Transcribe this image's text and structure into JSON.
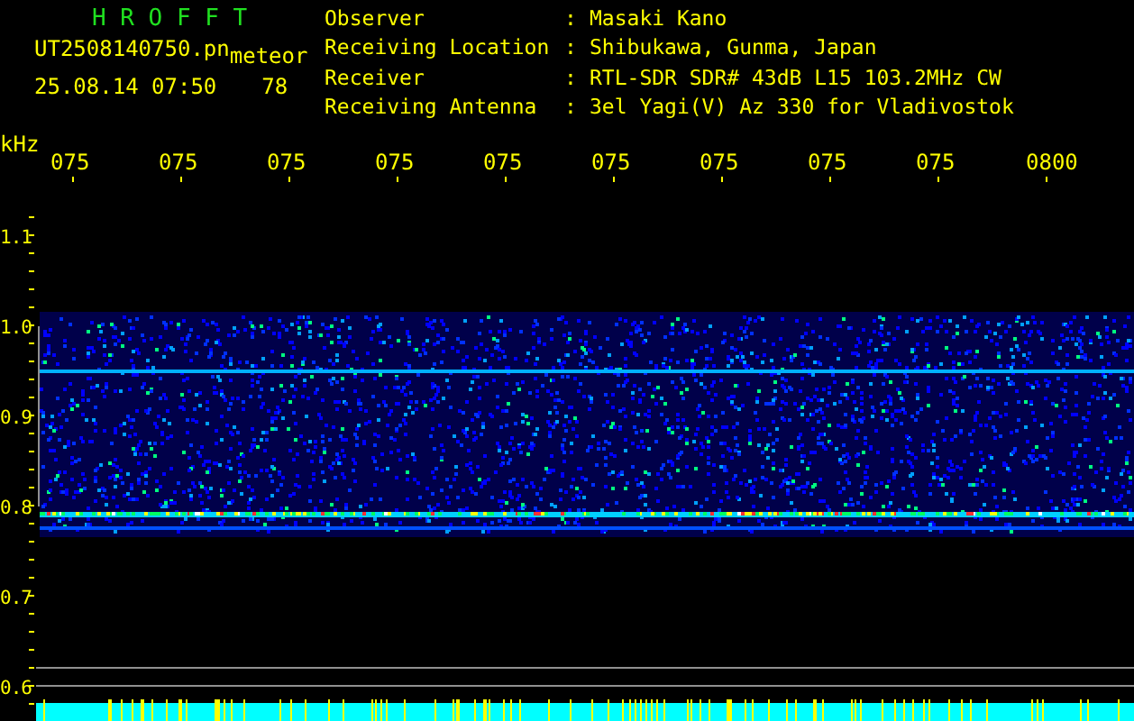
{
  "header": {
    "title": "H R O F F T",
    "file_name": "UT2508140750.pn",
    "tag": "meteor",
    "timestamp": "25.08.14 07:50",
    "count": "78"
  },
  "info": [
    {
      "label": "Observer",
      "separator": ":",
      "value": "Masaki Kano"
    },
    {
      "label": "Receiving Location",
      "separator": ":",
      "value": "Shibukawa, Gunma, Japan"
    },
    {
      "label": "Receiver",
      "separator": ":",
      "value": "RTL-SDR SDR# 43dB L15 103.2MHz CW"
    },
    {
      "label": "Receiving Antenna",
      "separator": ":",
      "value": "3el Yagi(V) Az 330 for Vladivostok"
    }
  ],
  "y_axis": {
    "unit": "kHz",
    "labels": [
      "1.1",
      "1.0",
      "0.9",
      "0.8",
      "0.7",
      "0.6"
    ]
  },
  "time_labels": [
    "075",
    "075",
    "075",
    "075",
    "075",
    "075",
    "075",
    "075",
    "075",
    "0800"
  ]
}
